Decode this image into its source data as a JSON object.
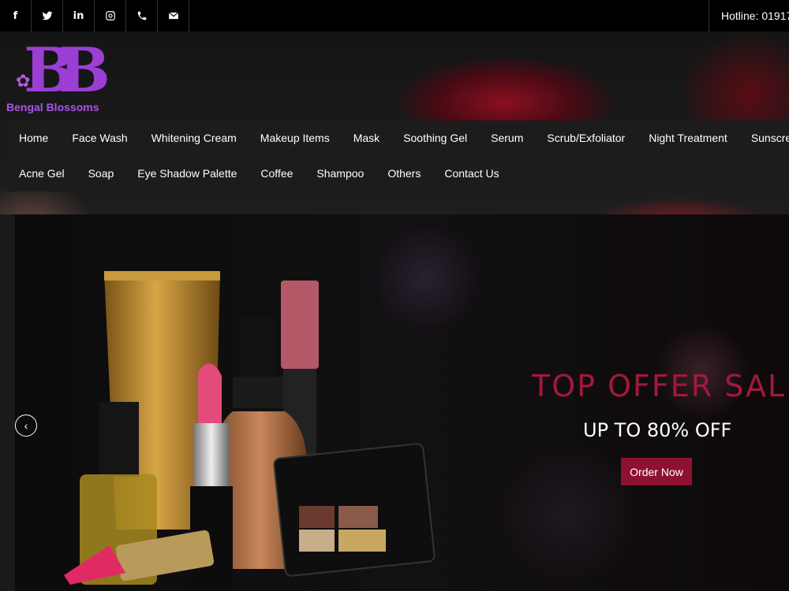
{
  "social": [
    {
      "icon": "facebook-icon",
      "glyph": "f"
    },
    {
      "icon": "twitter-icon"
    },
    {
      "icon": "linkedin-icon",
      "glyph": "in"
    },
    {
      "icon": "instagram-icon"
    },
    {
      "icon": "phone-icon"
    },
    {
      "icon": "email-icon"
    }
  ],
  "hotline": "Hotline: 01917",
  "logo": {
    "mark": "BB",
    "text": "Bengal Blossoms",
    "flower": "✿"
  },
  "nav": {
    "row1": [
      "Home",
      "Face Wash",
      "Whitening Cream",
      "Makeup Items",
      "Mask",
      "Soothing Gel",
      "Serum",
      "Scrub/Exfoliator",
      "Night Treatment",
      "Sunscreen"
    ],
    "row2": [
      "Acne Gel",
      "Soap",
      "Eye Shadow Palette",
      "Coffee",
      "Shampoo",
      "Others",
      "Contact Us"
    ]
  },
  "hero": {
    "title": "TOP OFFER SALE",
    "subtitle": "UP TO 80% OFF",
    "button": "Order Now",
    "prev": "‹"
  },
  "colors": {
    "accent": "#a3193a",
    "button": "#8e1230",
    "logo": "#9b3fd4"
  }
}
